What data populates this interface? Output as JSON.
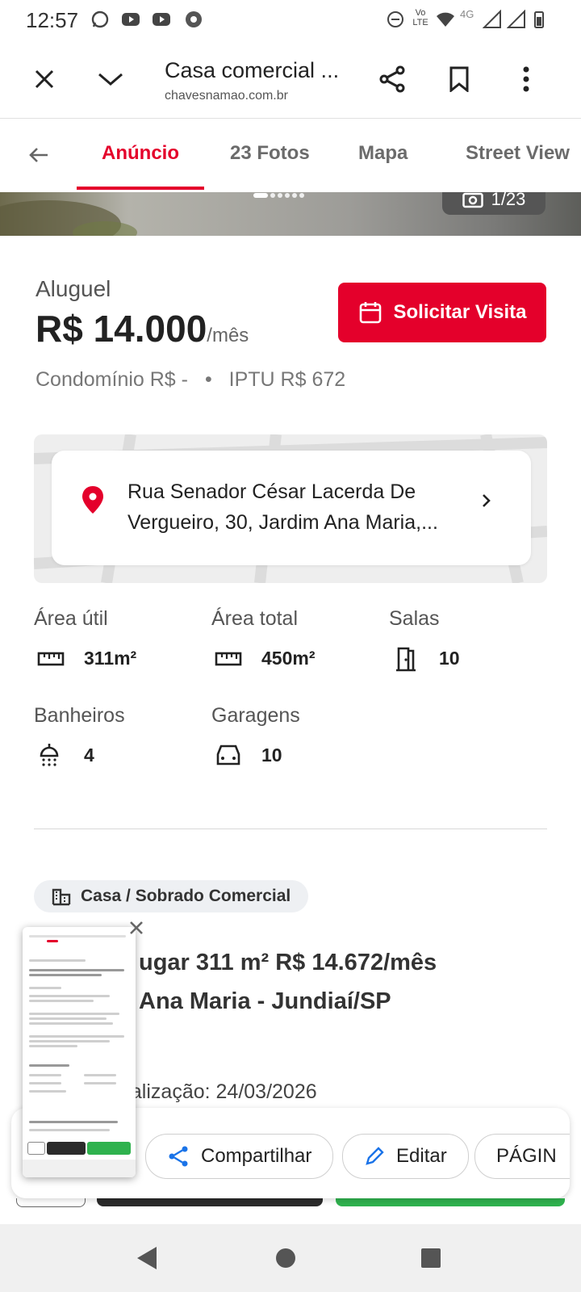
{
  "status_bar": {
    "time": "12:57",
    "network": "4G",
    "volte": "Vo LTE"
  },
  "browser": {
    "page_title": "Casa comercial ...",
    "domain": "chavesnamao.com.br"
  },
  "tabs": [
    {
      "label": "Anúncio",
      "active": true
    },
    {
      "label": "23 Fotos",
      "active": false
    },
    {
      "label": "Mapa",
      "active": false
    },
    {
      "label": "Street View",
      "active": false
    }
  ],
  "photo": {
    "counter": "1/23"
  },
  "listing": {
    "deal_type": "Aluguel",
    "price": "R$ 14.000",
    "price_unit": "/mês",
    "condominio": "Condomínio R$ -",
    "separator": "•",
    "iptu": "IPTU R$ 672",
    "visit_button": "Solicitar Visita",
    "address": "Rua Senador César Lacerda De Vergueiro, 30, Jardim Ana Maria,...",
    "features": [
      {
        "label": "Área útil",
        "value": "311m²",
        "icon": "ruler-icon"
      },
      {
        "label": "Área total",
        "value": "450m²",
        "icon": "ruler-icon"
      },
      {
        "label": "Salas",
        "value": "10",
        "icon": "door-icon"
      },
      {
        "label": "Banheiros",
        "value": "4",
        "icon": "shower-icon"
      },
      {
        "label": "Garagens",
        "value": "10",
        "icon": "car-icon"
      }
    ],
    "category": "Casa / Sobrado Comercial",
    "headline_line1": "ugar 311 m² R$ 14.672/mês",
    "headline_line2": "Ana Maria - Jundiaí/SP",
    "update": "ualização: 24/03/2026"
  },
  "share_sheet": {
    "share_label": "Compartilhar",
    "edit_label": "Editar",
    "page_label": "PÁGIN"
  },
  "colors": {
    "brand": "#e4002b",
    "green": "#2fb24e"
  }
}
